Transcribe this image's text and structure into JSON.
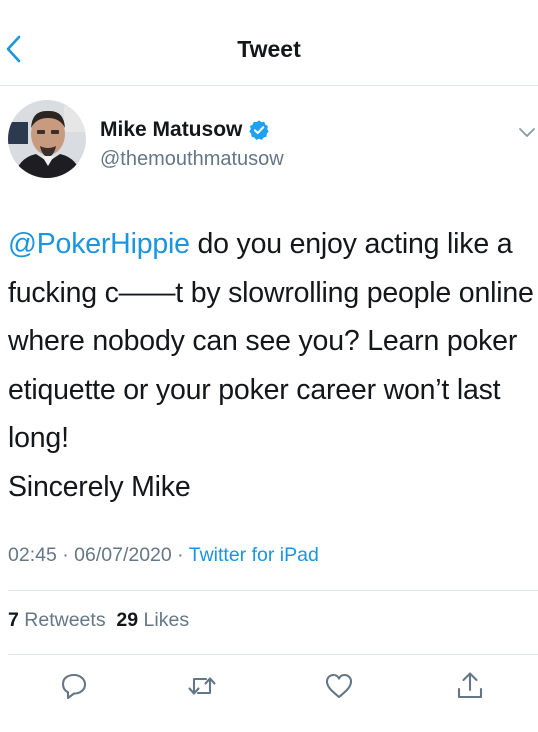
{
  "header": {
    "title": "Tweet",
    "back_icon": "chevron-left-icon"
  },
  "author": {
    "name": "Mike Matusow",
    "handle": "@themouthmatusow",
    "verified_icon": "verified-badge-icon",
    "menu_icon": "chevron-down-icon"
  },
  "tweet": {
    "mention": "@PokerHippie",
    "text_after_mention": " do you enjoy acting like a fucking c——t by slowrolling people online where nobody can see you? Learn poker etiquette or your poker career won’t last long!",
    "signoff": "Sincerely Mike"
  },
  "meta": {
    "time": "02:45",
    "separator": " · ",
    "date": "06/07/2020",
    "separator2": " · ",
    "source": "Twitter for iPad"
  },
  "stats": {
    "retweets_count": "7",
    "retweets_label": "Retweets",
    "likes_count": "29",
    "likes_label": "Likes"
  },
  "actions": {
    "reply_icon": "reply-icon",
    "retweet_icon": "retweet-icon",
    "like_icon": "heart-icon",
    "share_icon": "share-icon"
  },
  "colors": {
    "accent": "#1b95e0",
    "text": "#14171a",
    "secondary": "#657786",
    "divider": "#e1e8ed"
  }
}
